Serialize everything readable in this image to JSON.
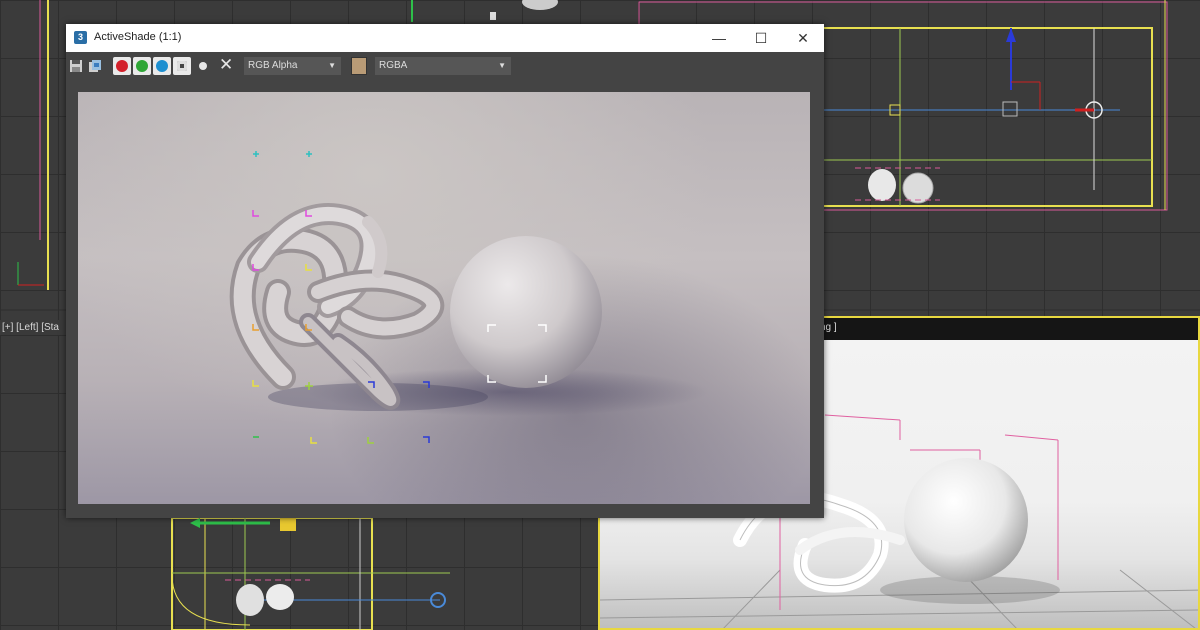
{
  "activeshade": {
    "title": "ActiveShade (1:1)",
    "app_icon_glyph": "3",
    "minimize_glyph": "—",
    "maximize_glyph": "☐",
    "close_glyph": "✕",
    "toolbar": {
      "channel_display": "RGB Alpha",
      "channel_mode": "RGBA",
      "dropdown_arrow": "▼",
      "red_channel_color": "#d3202a",
      "green_channel_color": "#2fa636",
      "blue_channel_color": "#1d8fd0",
      "swatch_color": "#b99b76",
      "clear_glyph": "✕"
    }
  },
  "viewports": {
    "left_label": "[+] [Left] [Sta",
    "perspective_label": "ng ]"
  }
}
